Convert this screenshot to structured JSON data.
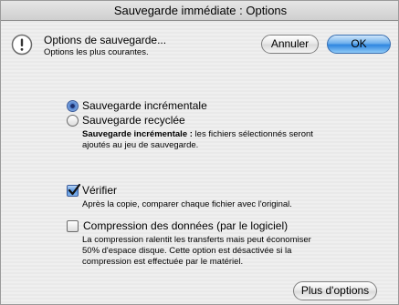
{
  "window": {
    "title": "Sauvegarde immédiate : Options"
  },
  "header": {
    "icon": "alert-icon",
    "title": "Options de sauvegarde...",
    "subtitle": "Options les plus courantes."
  },
  "buttons": {
    "cancel_label": "Annuler",
    "ok_label": "OK",
    "more_options_label": "Plus d'options"
  },
  "backup_mode": {
    "selected": "incremental",
    "options": [
      {
        "label": "Sauvegarde incrémentale",
        "selected": true
      },
      {
        "label": "Sauvegarde recyclée",
        "selected": false
      }
    ],
    "description_bold": "Sauvegarde incrémentale :",
    "description_line1_rest": " les fichiers sélectionnés seront",
    "description_line2": "ajoutés au jeu de sauvegarde."
  },
  "verify": {
    "label": "Vérifier",
    "checked": true,
    "description": "Après la copie, comparer chaque fichier avec l'original."
  },
  "compression": {
    "label": "Compression des données (par le logiciel)",
    "checked": false,
    "description_line1": "La compression ralentit les transferts mais peut économiser",
    "description_line2": "50% d'espace disque. Cette option est désactivée si la",
    "description_line3": "compression est effectuée par le matériel."
  },
  "colors": {
    "accent": "#2f86e0",
    "window_bg": "#ececec"
  }
}
